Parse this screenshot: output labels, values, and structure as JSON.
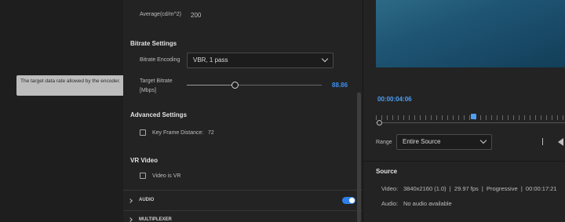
{
  "tooltip": {
    "text": "The target data rate allowed by the encoder."
  },
  "hdr": {
    "average_label": "Average(cd/m^2)",
    "average_value": "200"
  },
  "bitrate": {
    "title": "Bitrate Settings",
    "encoding_label": "Bitrate Encoding",
    "encoding_value": "VBR, 1 pass",
    "target_label_line1": "Target Bitrate",
    "target_label_line2": "[Mbps]",
    "target_value": "88.86",
    "target_fraction": 0.36
  },
  "advanced": {
    "title": "Advanced Settings",
    "keyframe_label": "Key Frame Distance:",
    "keyframe_value": "72"
  },
  "vr": {
    "title": "VR Video",
    "checkbox_label": "Video is VR"
  },
  "sections": {
    "audio": "AUDIO",
    "multiplexer": "MULTIPLEXER"
  },
  "preview": {
    "timecode": "00:00:04:06",
    "range_label": "Range",
    "range_value": "Entire Source",
    "playhead_fraction": 0.5
  },
  "source": {
    "title": "Source",
    "video_label": "Video:",
    "video_value": "3840x2160 (1.0)  |  29.97 fps  |  Progressive  |  00:00:17:21",
    "audio_label": "Audio:",
    "audio_value": "No audio available"
  },
  "colors": {
    "accent": "#3b8ff0",
    "tooltip_bg": "#bdbdbd"
  }
}
